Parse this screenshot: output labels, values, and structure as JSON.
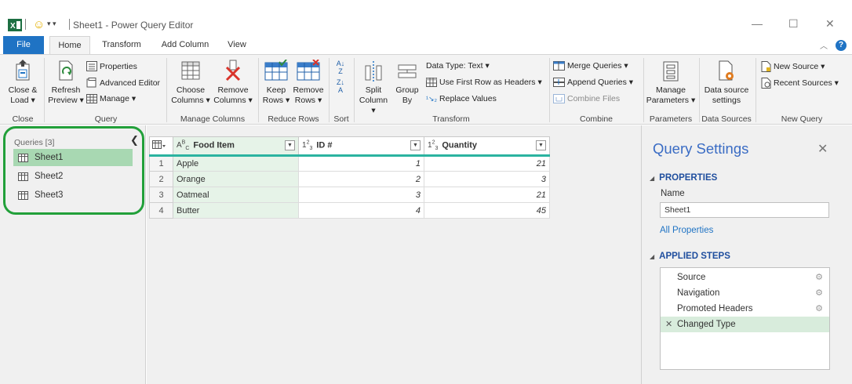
{
  "titlebar": {
    "title": "Sheet1 - Power Query Editor",
    "quick_access_arrows": "▾ ▾",
    "minimize_glyph": "—",
    "maximize_glyph": "☐",
    "close_glyph": "✕"
  },
  "tabs": [
    "File",
    "Home",
    "Transform",
    "Add Column",
    "View"
  ],
  "ribbon": {
    "close_load": [
      "Close &",
      "Load ▾"
    ],
    "refresh_preview": [
      "Refresh",
      "Preview ▾"
    ],
    "properties": "Properties",
    "advanced_editor": "Advanced Editor",
    "manage": "Manage ▾",
    "choose_columns": [
      "Choose",
      "Columns ▾"
    ],
    "remove_columns": [
      "Remove",
      "Columns ▾"
    ],
    "keep_rows": [
      "Keep",
      "Rows ▾"
    ],
    "remove_rows": [
      "Remove",
      "Rows ▾"
    ],
    "split_column": [
      "Split",
      "Column ▾"
    ],
    "group_by": [
      "Group",
      "By"
    ],
    "data_type": "Data Type: Text ▾",
    "use_first_row": "Use First Row as Headers ▾",
    "replace_values": "Replace Values",
    "merge_queries": "Merge Queries ▾",
    "append_queries": "Append Queries ▾",
    "combine_files": "Combine Files",
    "manage_parameters": [
      "Manage",
      "Parameters ▾"
    ],
    "data_source_settings": [
      "Data source",
      "settings"
    ],
    "new_source": "New Source ▾",
    "recent_sources": "Recent Sources ▾",
    "groups": {
      "close": "Close",
      "query": "Query",
      "manage_columns": "Manage Columns",
      "reduce_rows": "Reduce Rows",
      "sort": "Sort",
      "transform": "Transform",
      "combine": "Combine",
      "parameters": "Parameters",
      "data_sources": "Data Sources",
      "new_query": "New Query"
    }
  },
  "queries": {
    "header": "Queries [3]",
    "items": [
      "Sheet1",
      "Sheet2",
      "Sheet3"
    ],
    "selected": "Sheet1"
  },
  "grid": {
    "columns": [
      {
        "type": "ABC",
        "name": "Food Item"
      },
      {
        "type": "123",
        "name": "ID #"
      },
      {
        "type": "123",
        "name": "Quantity"
      }
    ],
    "rows": [
      {
        "n": "1",
        "food": "Apple",
        "id": "1",
        "qty": "21"
      },
      {
        "n": "2",
        "food": "Orange",
        "id": "2",
        "qty": "3"
      },
      {
        "n": "3",
        "food": "Oatmeal",
        "id": "3",
        "qty": "21"
      },
      {
        "n": "4",
        "food": "Butter",
        "id": "4",
        "qty": "45"
      }
    ]
  },
  "settings": {
    "title": "Query Settings",
    "properties_header": "PROPERTIES",
    "name_label": "Name",
    "name_value": "Sheet1",
    "all_properties": "All Properties",
    "applied_steps_header": "APPLIED STEPS",
    "steps": [
      "Source",
      "Navigation",
      "Promoted Headers",
      "Changed Type"
    ],
    "selected_step": "Changed Type"
  },
  "colors": {
    "file_tab": "#1f73c4",
    "selected_query": "#a8d8b2",
    "highlight_ring": "#22a03a",
    "header_underline": "#2bb3a0",
    "settings_title": "#3a6cc4"
  }
}
